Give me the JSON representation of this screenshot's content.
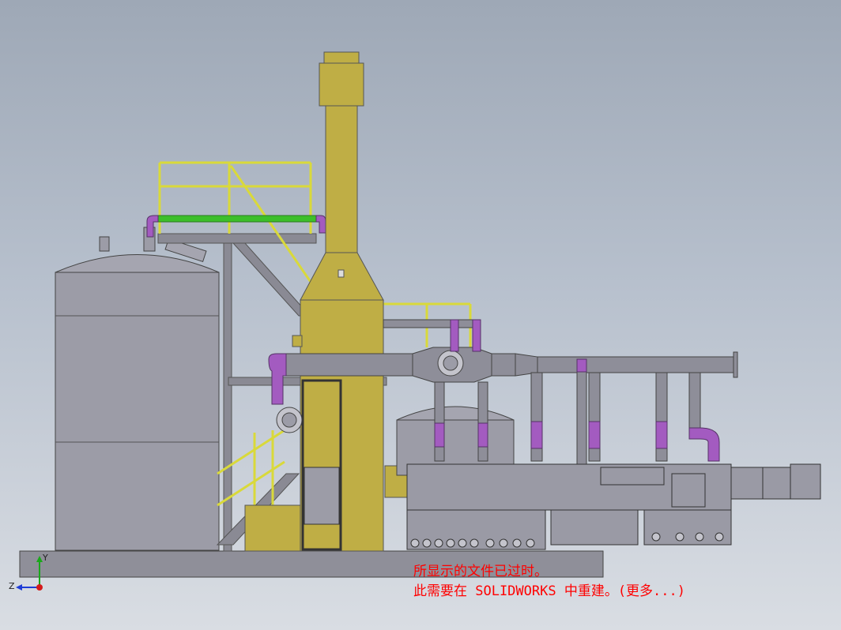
{
  "viewport": {
    "warning_line1": "所显示的文件已过时。",
    "warning_line2": "此需要在 SOLIDWORKS 中重建。(更多...)",
    "warning_color": "#ff0000",
    "background_top": "#9ea8b6",
    "background_bottom": "#d9dde3"
  },
  "triad": {
    "y_label": "Y",
    "z_label": "Z",
    "y_color": "#1aa81a",
    "z_color": "#1e3cd6",
    "x_color": "#d41a1a"
  },
  "model": {
    "stack_color": "#bfae45",
    "tank_color": "#9b9ba6",
    "pipe_color": "#8e8e99",
    "elbow_color": "#a35bc0",
    "rail_color": "#d9d93a",
    "highlight_pipe_color": "#3cbf2a"
  }
}
